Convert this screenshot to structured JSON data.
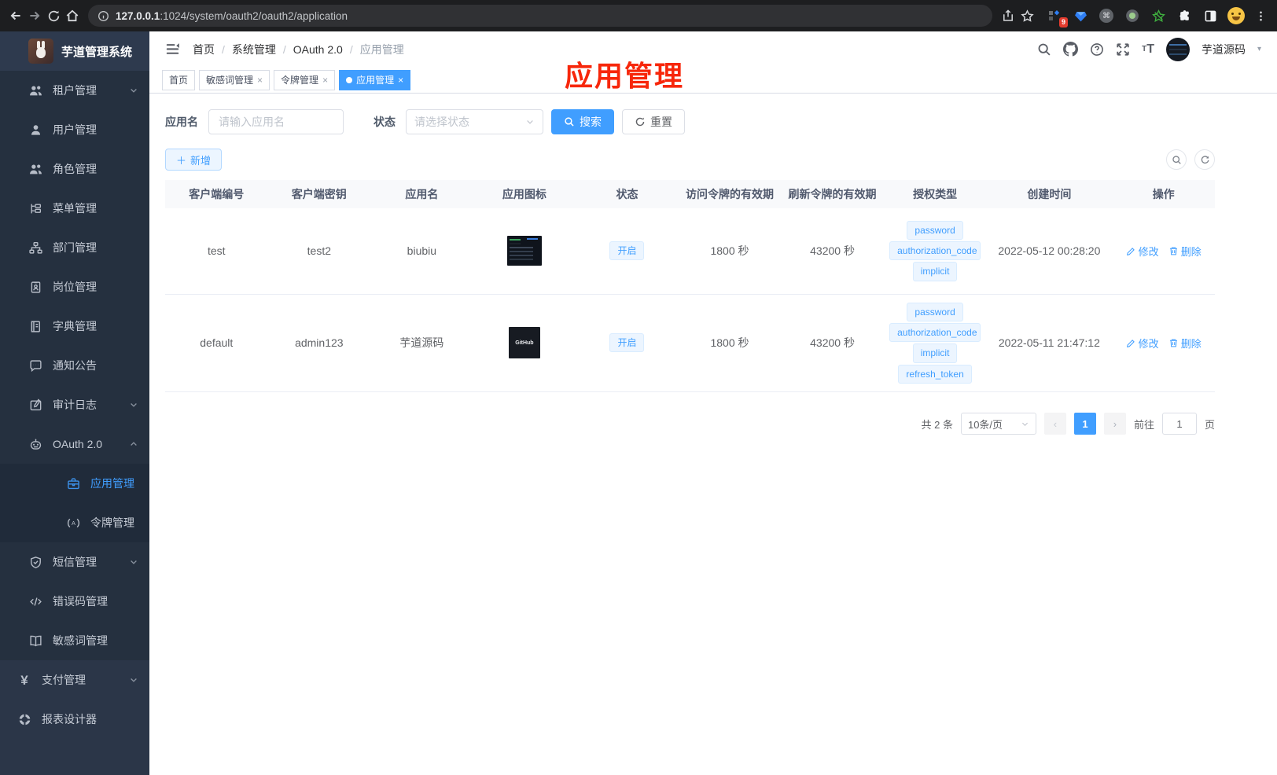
{
  "browser": {
    "url_domain": "127.0.0.1",
    "url_path": ":1024/system/oauth2/oauth2/application",
    "extension_badge": "9"
  },
  "app": {
    "title": "芋道管理系统"
  },
  "sidebar": {
    "items": [
      {
        "id": "tenant",
        "label": "租户管理",
        "icon": "users-icon",
        "chevron": "down"
      },
      {
        "id": "user",
        "label": "用户管理",
        "icon": "user-icon"
      },
      {
        "id": "role",
        "label": "角色管理",
        "icon": "roles-icon"
      },
      {
        "id": "menu",
        "label": "菜单管理",
        "icon": "menu-tree-icon"
      },
      {
        "id": "dept",
        "label": "部门管理",
        "icon": "org-chart-icon"
      },
      {
        "id": "post",
        "label": "岗位管理",
        "icon": "badge-icon"
      },
      {
        "id": "dict",
        "label": "字典管理",
        "icon": "dictionary-icon"
      },
      {
        "id": "notice",
        "label": "通知公告",
        "icon": "announcement-icon"
      },
      {
        "id": "audit-log",
        "label": "审计日志",
        "icon": "log-icon",
        "chevron": "down"
      },
      {
        "id": "oauth2",
        "label": "OAuth 2.0",
        "icon": "robot-icon",
        "chevron": "up"
      },
      {
        "id": "oauth2-application",
        "label": "应用管理",
        "icon": "briefcase-icon",
        "sub": true,
        "active": true
      },
      {
        "id": "oauth2-token",
        "label": "令牌管理",
        "icon": "token-icon",
        "sub": true
      },
      {
        "id": "sms",
        "label": "短信管理",
        "icon": "shield-icon",
        "chevron": "down"
      },
      {
        "id": "error-code",
        "label": "错误码管理",
        "icon": "code-icon"
      },
      {
        "id": "sensitive-word",
        "label": "敏感词管理",
        "icon": "open-book-icon"
      },
      {
        "id": "pay",
        "label": "支付管理",
        "icon": "yen-icon",
        "chevron": "down",
        "root": true
      },
      {
        "id": "report",
        "label": "报表设计器",
        "icon": "segments-icon",
        "root": true
      }
    ]
  },
  "header": {
    "breadcrumb": [
      "首页",
      "系统管理",
      "OAuth 2.0",
      "应用管理"
    ],
    "user_name": "芋道源码"
  },
  "tabs": [
    {
      "label": "首页"
    },
    {
      "label": "敏感词管理",
      "closable": true
    },
    {
      "label": "令牌管理",
      "closable": true
    },
    {
      "label": "应用管理",
      "closable": true,
      "active": true
    }
  ],
  "annotation": {
    "text": "应用管理",
    "color": "#f7270b"
  },
  "filter": {
    "app_name_label": "应用名",
    "app_name_placeholder": "请输入应用名",
    "status_label": "状态",
    "status_placeholder": "请选择状态",
    "search_label": "搜索",
    "reset_label": "重置"
  },
  "toolbar": {
    "add_label": "新增"
  },
  "table": {
    "columns": [
      "客户端编号",
      "客户端密钥",
      "应用名",
      "应用图标",
      "状态",
      "访问令牌的有效期",
      "刷新令牌的有效期",
      "授权类型",
      "创建时间",
      "操作"
    ],
    "actions": {
      "edit_label": "修改",
      "delete_label": "删除"
    },
    "rows": [
      {
        "client_id": "test",
        "secret": "test2",
        "name": "biubiu",
        "icon": {
          "type": "screenshot-thumb",
          "label": ""
        },
        "status": "开启",
        "access_ttl": "1800 秒",
        "refresh_ttl": "43200 秒",
        "grants": [
          "password",
          "authorization_code",
          "implicit"
        ],
        "created": "2022-05-12 00:28:20"
      },
      {
        "client_id": "default",
        "secret": "admin123",
        "name": "芋道源码",
        "icon": {
          "type": "github-thumb",
          "label": "GitHub"
        },
        "status": "开启",
        "access_ttl": "1800 秒",
        "refresh_ttl": "43200 秒",
        "grants": [
          "password",
          "authorization_code",
          "implicit",
          "refresh_token"
        ],
        "created": "2022-05-11 21:47:12"
      }
    ]
  },
  "pagination": {
    "total_label": "共 2 条",
    "page_size_label": "10条/页",
    "current_page": "1",
    "goto_label": "前往",
    "goto_value": "1",
    "page_unit_label": "页"
  },
  "colors": {
    "accent": "#409eff",
    "sidebar_bg": "#2b3648",
    "annotation_red": "#f7270b"
  }
}
